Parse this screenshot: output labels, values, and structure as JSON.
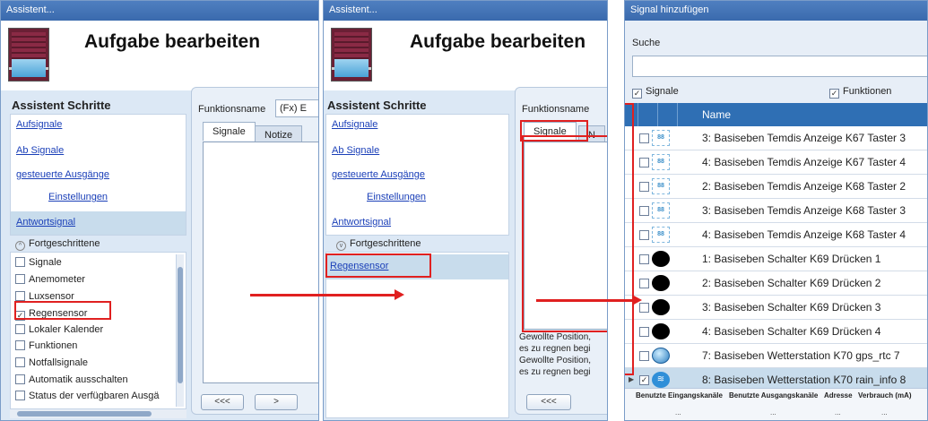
{
  "left": {
    "title": "Assistent...",
    "heading": "Aufgabe bearbeiten",
    "steps_title": "Assistent Schritte",
    "steps": [
      "Aufsignale",
      "Ab Signale",
      "gesteuerte Ausgänge",
      "Einstellungen",
      "Antwortsignal"
    ],
    "advanced": "Fortgeschrittene",
    "options": [
      {
        "label": "Signale",
        "checked": false
      },
      {
        "label": "Anemometer",
        "checked": false
      },
      {
        "label": "Luxsensor",
        "checked": false
      },
      {
        "label": "Regensensor",
        "checked": true
      },
      {
        "label": "Lokaler Kalender",
        "checked": false
      },
      {
        "label": "Funktionen",
        "checked": false
      },
      {
        "label": "Notfallsignale",
        "checked": false
      },
      {
        "label": "Automatik ausschalten",
        "checked": false
      },
      {
        "label": "Status der verfügbaren Ausgä",
        "checked": false
      }
    ],
    "funktionsname_label": "Funktionsname",
    "funktionsname_value": "(Fx) E",
    "tab1": "Signale",
    "tab2": "Notize",
    "btn_prev": "<<<",
    "btn_next": ">"
  },
  "middle": {
    "title": "Assistent...",
    "heading": "Aufgabe bearbeiten",
    "steps_title": "Assistent Schritte",
    "steps": [
      "Aufsignale",
      "Ab Signale",
      "gesteuerte Ausgänge",
      "Einstellungen",
      "Antwortsignal"
    ],
    "advanced": "Fortgeschrittene",
    "selected_item": "Regensensor",
    "funktionsname_label": "Funktionsname",
    "tab1": "Signale",
    "tab2": "N",
    "notes": [
      "Gewollte Position,",
      "es zu regnen begi",
      "Gewollte Position,",
      "es zu regnen begi"
    ],
    "btn_prev": "<<<"
  },
  "right": {
    "title": "Signal hinzufügen",
    "search_label": "Suche",
    "search_value": "",
    "filter_signale": "Signale",
    "filter_funktionen": "Funktionen",
    "col_name": "Name",
    "rows": [
      {
        "icon": "segment-display-icon",
        "name": "3: Basiseben Temdis Anzeige K67 Taster 3"
      },
      {
        "icon": "segment-display-icon",
        "name": "4: Basiseben Temdis Anzeige K67 Taster 4"
      },
      {
        "icon": "segment-display-icon",
        "name": "2: Basiseben Temdis Anzeige K68 Taster 2"
      },
      {
        "icon": "segment-display-icon",
        "name": "3: Basiseben Temdis Anzeige K68 Taster 3"
      },
      {
        "icon": "segment-display-icon",
        "name": "4: Basiseben Temdis Anzeige K68 Taster 4"
      },
      {
        "icon": "switch-icon",
        "name": "1: Basiseben Schalter K69 Drücken 1"
      },
      {
        "icon": "switch-icon",
        "name": "2: Basiseben Schalter K69 Drücken 2"
      },
      {
        "icon": "switch-icon",
        "name": "3: Basiseben Schalter K69 Drücken 3"
      },
      {
        "icon": "switch-icon",
        "name": "4: Basiseben Schalter K69 Drücken 4"
      },
      {
        "icon": "globe-icon",
        "name": "7: Basiseben Wetterstation K70 gps_rtc 7"
      },
      {
        "icon": "wireless-icon",
        "name": "8: Basiseben Wetterstation K70 rain_info 8",
        "checked": true
      }
    ],
    "footer_headers": [
      "Benutzte Eingangskanäle",
      "Benutzte Ausgangskanäle",
      "Adresse",
      "Verbrauch (mA)"
    ],
    "footer_values": [
      "...",
      "...",
      "...",
      "..."
    ]
  }
}
